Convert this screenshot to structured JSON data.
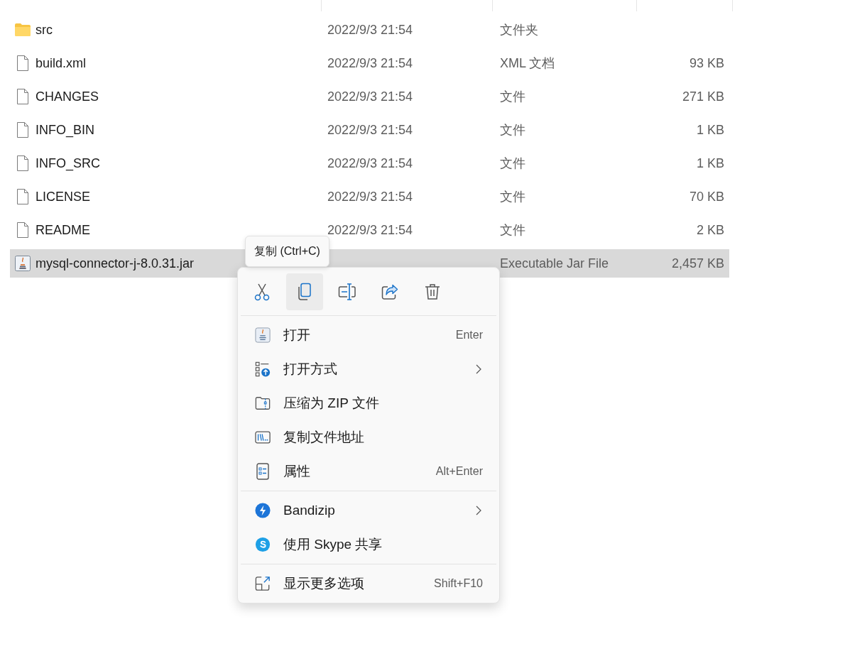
{
  "files": [
    {
      "kind": "folder",
      "name": "src",
      "modified": "2022/9/3 21:54",
      "type": "文件夹",
      "selected": false
    },
    {
      "kind": "file",
      "name": "build.xml",
      "modified": "2022/9/3 21:54",
      "type": "XML 文档",
      "size": "93 KB",
      "selected": false
    },
    {
      "kind": "file",
      "name": "CHANGES",
      "modified": "2022/9/3 21:54",
      "type": "文件",
      "size": "271 KB",
      "selected": false
    },
    {
      "kind": "file",
      "name": "INFO_BIN",
      "modified": "2022/9/3 21:54",
      "type": "文件",
      "size": "1 KB",
      "selected": false
    },
    {
      "kind": "file",
      "name": "INFO_SRC",
      "modified": "2022/9/3 21:54",
      "type": "文件",
      "size": "1 KB",
      "selected": false
    },
    {
      "kind": "file",
      "name": "LICENSE",
      "modified": "2022/9/3 21:54",
      "type": "文件",
      "size": "70 KB",
      "selected": false
    },
    {
      "kind": "file",
      "name": "README",
      "modified": "2022/9/3 21:54",
      "type": "文件",
      "size": "2 KB",
      "selected": false
    },
    {
      "kind": "jar",
      "name": "mysql-connector-j-8.0.31.jar",
      "type": "Executable Jar File",
      "size": "2,457 KB",
      "selected": true
    }
  ],
  "tooltip": {
    "text": "复制 (Ctrl+C)"
  },
  "context_menu": {
    "toolbar": [
      {
        "kind": "cut",
        "hovered": false
      },
      {
        "kind": "copy",
        "hovered": true
      },
      {
        "kind": "rename",
        "hovered": false
      },
      {
        "kind": "share",
        "hovered": false
      },
      {
        "kind": "delete",
        "hovered": false
      }
    ],
    "groups": [
      [
        {
          "kind": "java",
          "label": "打开",
          "shortcut": "Enter",
          "submenu": false
        },
        {
          "kind": "open-with",
          "label": "打开方式",
          "submenu": true
        },
        {
          "kind": "zip",
          "label": "压缩为 ZIP 文件",
          "submenu": false
        },
        {
          "kind": "path",
          "label": "复制文件地址",
          "submenu": false
        },
        {
          "kind": "properties",
          "label": "属性",
          "shortcut": "Alt+Enter",
          "submenu": false
        }
      ],
      [
        {
          "kind": "bandizip",
          "label": "Bandizip",
          "submenu": true
        },
        {
          "kind": "skype",
          "label": "使用 Skype 共享",
          "submenu": false
        }
      ],
      [
        {
          "kind": "more",
          "label": "显示更多选项",
          "shortcut": "Shift+F10",
          "submenu": false
        }
      ]
    ]
  }
}
